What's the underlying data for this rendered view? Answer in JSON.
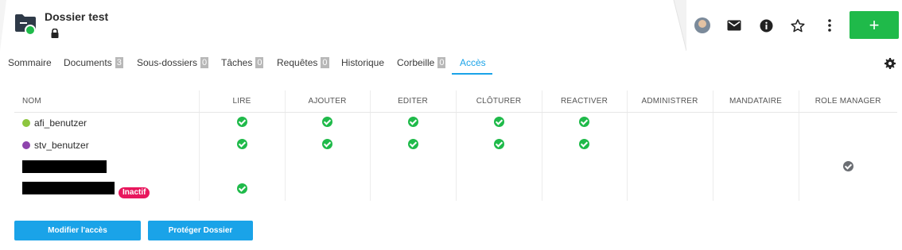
{
  "header": {
    "title": "Dossier test",
    "folder_icon": "folder-icon",
    "lock_icon": "lock-icon",
    "status_color": "#1fba4a"
  },
  "actions": [
    {
      "icon": "avatar"
    },
    {
      "icon": "mail-icon"
    },
    {
      "icon": "info-icon"
    },
    {
      "icon": "star-icon"
    },
    {
      "icon": "more-vertical-icon"
    }
  ],
  "add_button": {
    "label": "+",
    "color": "#1fba4a"
  },
  "tabs": [
    {
      "label": "Sommaire"
    },
    {
      "label": "Documents",
      "count": "3"
    },
    {
      "label": "Sous-dossiers",
      "count": "0"
    },
    {
      "label": "Tâches",
      "count": "0"
    },
    {
      "label": "Requêtes",
      "count": "0"
    },
    {
      "label": "Historique"
    },
    {
      "label": "Corbeille",
      "count": "0"
    },
    {
      "label": "Accès",
      "active": true
    }
  ],
  "accent_color": "#1aa3e8",
  "table": {
    "columns": [
      "NOM",
      "LIRE",
      "AJOUTER",
      "EDITER",
      "CLÔTURER",
      "REACTIVER",
      "ADMINISTRER",
      "MANDATAIRE",
      "ROLE MANAGER"
    ],
    "rows": [
      {
        "name": "afi_benutzer",
        "icon": "group-icon",
        "perms": [
          true,
          true,
          true,
          true,
          true,
          false,
          false,
          false
        ]
      },
      {
        "name": "stv_benutzer",
        "icon": "user-icon",
        "perms": [
          true,
          true,
          true,
          true,
          true,
          false,
          false,
          false
        ]
      },
      {
        "name": "",
        "redacted": true,
        "perms": [
          false,
          false,
          false,
          false,
          false,
          false,
          false,
          "grey"
        ]
      },
      {
        "name": "",
        "redacted": true,
        "badge": "Inactif",
        "perms": [
          true,
          false,
          false,
          false,
          false,
          false,
          false,
          false
        ]
      }
    ]
  },
  "buttons": {
    "modify": "Modifier l'accès",
    "protect": "Protéger Dossier"
  }
}
